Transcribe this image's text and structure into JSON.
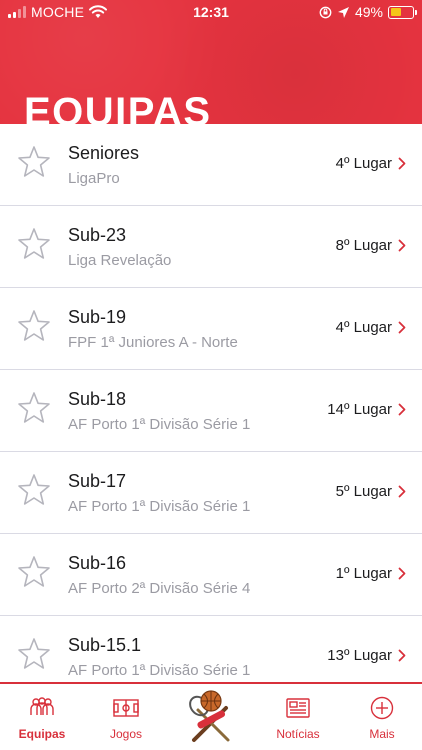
{
  "status_bar": {
    "carrier": "MOCHE",
    "time": "12:31",
    "battery": "49%",
    "battery_level": 0.49
  },
  "header": {
    "title": "EQUIPAS",
    "color": "#e5333f"
  },
  "teams": [
    {
      "name": "Seniores",
      "league": "LigaPro",
      "position": "4º Lugar"
    },
    {
      "name": "Sub-23",
      "league": "Liga Revelação",
      "position": "8º Lugar"
    },
    {
      "name": "Sub-19",
      "league": "FPF 1ª Juniores A - Norte",
      "position": "4º Lugar"
    },
    {
      "name": "Sub-18",
      "league": "AF Porto 1ª Divisão Série 1",
      "position": "14º Lugar"
    },
    {
      "name": "Sub-17",
      "league": "AF Porto 1ª Divisão Série 1",
      "position": "5º Lugar"
    },
    {
      "name": "Sub-16",
      "league": "AF Porto 2ª Divisão Série 4",
      "position": "1º Lugar"
    },
    {
      "name": "Sub-15.1",
      "league": "AF Porto 1ª Divisão Série 1",
      "position": "13º Lugar"
    }
  ],
  "tabbar": {
    "tabs": [
      {
        "label": "Equipas",
        "icon": "team-icon",
        "active": true
      },
      {
        "label": "Jogos",
        "icon": "field-icon",
        "active": false
      },
      {
        "label": "Notícias",
        "icon": "newspaper-icon",
        "active": false
      },
      {
        "label": "Mais",
        "icon": "plus-circle-icon",
        "active": false
      }
    ],
    "center_icon": "sports-logo-icon",
    "accent": "#d8303b"
  }
}
